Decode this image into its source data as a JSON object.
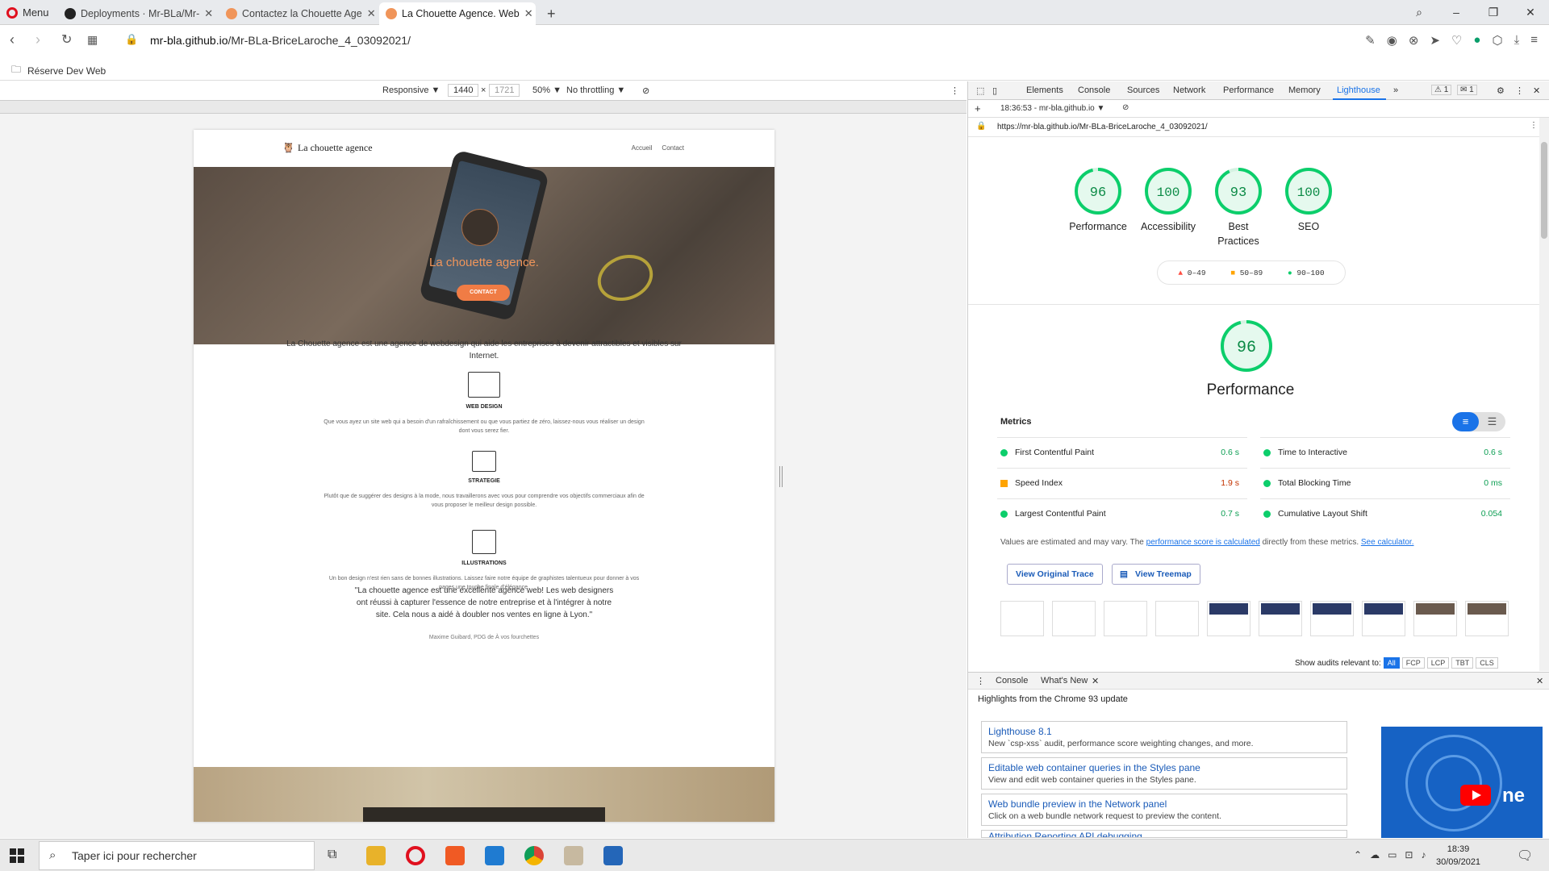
{
  "browser": {
    "menu_label": "Menu",
    "tabs": [
      {
        "title": "Deployments · Mr-BLa/Mr-"
      },
      {
        "title": "Contactez la Chouette Age"
      },
      {
        "title": "La Chouette Agence. Web"
      }
    ],
    "url_host": "mr-bla.github.io",
    "url_path": "/Mr-BLa-BriceLaroche_4_03092021/",
    "bookmark": "Réserve Dev Web"
  },
  "device_toolbar": {
    "mode": "Responsive ▼",
    "width": "1440",
    "times": "×",
    "height": "1721",
    "zoom": "50% ▼",
    "throttling": "No throttling ▼"
  },
  "site": {
    "logo": "La chouette agence",
    "nav": [
      "Accueil",
      "Contact"
    ],
    "hero_title": "La chouette agence.",
    "cta": "CONTACT",
    "intro": "La Chouette agence est une agence de webdesign qui aide les entreprises à devenir attractibles et visibles sur Internet.",
    "services": [
      {
        "icon": "web-design-icon",
        "title": "WEB DESIGN",
        "desc": "Que vous ayez un site web qui a besoin d'un rafraîchissement ou que vous partiez de zéro, laissez-nous vous réaliser un design dont vous serez fier."
      },
      {
        "icon": "strategy-chart-icon",
        "title": "STRATEGIE",
        "desc": "Plutôt que de suggérer des designs à la mode, nous travaillerons avec vous pour comprendre vos objectifs commerciaux afin de vous proposer le meilleur design possible."
      },
      {
        "icon": "pencil-icon",
        "title": "ILLUSTRATIONS",
        "desc": "Un bon design n'est rien sans de bonnes illustrations. Laissez faire notre équipe de graphistes talentueux pour donner à vos pages une touche finale d'élégance."
      }
    ],
    "quote": "\"La chouette agence est une excellente agence web! Les web designers ont réussi à capturer l'essence de notre entreprise et à l'intégrer à notre site. Cela nous a aidé à doubler nos ventes en ligne à Lyon.\"",
    "quote_author": "Maxime Guibard, PDG de À vos fourchettes"
  },
  "devtools": {
    "tabs": [
      "Elements",
      "Console",
      "Sources",
      "Network",
      "Performance",
      "Memory",
      "Lighthouse",
      "»"
    ],
    "selected_tab": "Lighthouse",
    "warnings": "1",
    "messages": "1",
    "report_label": "18:36:53 - mr-bla.github.io ▼",
    "report_url": "https://mr-bla.github.io/Mr-BLa-BriceLaroche_4_03092021/",
    "scores": [
      {
        "value": 96,
        "label": "Performance"
      },
      {
        "value": 100,
        "label": "Accessibility"
      },
      {
        "value": 93,
        "label": "Best Practices"
      },
      {
        "value": 100,
        "label": "SEO"
      }
    ],
    "legend": [
      "0–49",
      "50–89",
      "90–100"
    ],
    "perf_score": 96,
    "perf_title": "Performance",
    "metrics_heading": "Metrics",
    "metrics": [
      {
        "name": "First Contentful Paint",
        "value": "0.6 s",
        "status": "good"
      },
      {
        "name": "Time to Interactive",
        "value": "0.6 s",
        "status": "good"
      },
      {
        "name": "Speed Index",
        "value": "1.9 s",
        "status": "average"
      },
      {
        "name": "Total Blocking Time",
        "value": "0 ms",
        "status": "good"
      },
      {
        "name": "Largest Contentful Paint",
        "value": "0.7 s",
        "status": "good"
      },
      {
        "name": "Cumulative Layout Shift",
        "value": "0.054",
        "status": "good"
      }
    ],
    "note_pre": "Values are estimated and may vary. The ",
    "note_link": "performance score is calculated",
    "note_mid": " directly from these metrics. ",
    "note_link2": "See calculator.",
    "btn_trace": "View Original Trace",
    "btn_treemap": "View Treemap",
    "show_audits": "Show audits relevant to:",
    "audit_filters": [
      "All",
      "FCP",
      "LCP",
      "TBT",
      "CLS"
    ],
    "drawer_tabs": [
      "Console",
      "What's New"
    ],
    "drawer_headline": "Highlights from the Chrome 93 update",
    "whatsnew": [
      {
        "title": "Lighthouse 8.1",
        "desc": "New `csp-xss` audit, performance score weighting changes, and more."
      },
      {
        "title": "Editable web container queries in the Styles pane",
        "desc": "View and edit web container queries in the Styles pane."
      },
      {
        "title": "Web bundle preview in the Network panel",
        "desc": "Click on a web bundle network request to preview the content."
      },
      {
        "title": "Attribution Reporting API debugging",
        "desc": ""
      }
    ],
    "video_text": "ne"
  },
  "taskbar": {
    "search_placeholder": "Taper ici pour rechercher",
    "time": "18:39",
    "date": "30/09/2021"
  },
  "colors": {
    "good": "#0cce6b",
    "average": "#ffa400",
    "poor": "#ff4e42",
    "accent": "#1a73e8"
  }
}
